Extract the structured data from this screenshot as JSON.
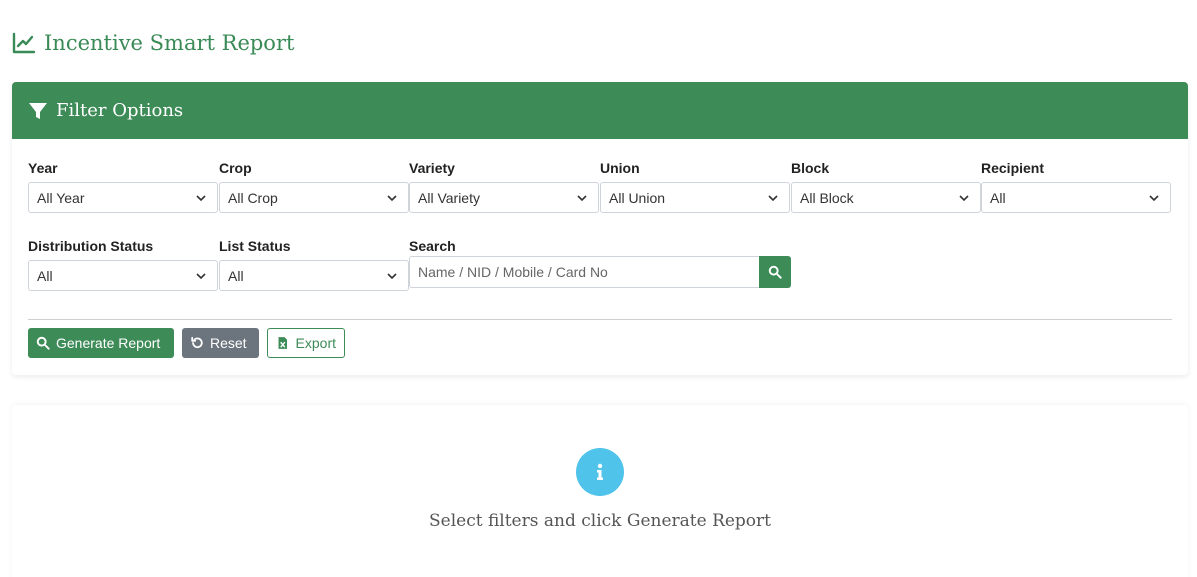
{
  "page": {
    "title": "Incentive Smart Report",
    "title_icon": "line-chart-icon"
  },
  "filter_panel": {
    "header": "Filter Options",
    "header_icon": "filter-icon",
    "fields": [
      {
        "label": "Year",
        "value": "All Year"
      },
      {
        "label": "Crop",
        "value": "All Crop"
      },
      {
        "label": "Variety",
        "value": "All Variety"
      },
      {
        "label": "Union",
        "value": "All Union"
      },
      {
        "label": "Block",
        "value": "All Block"
      },
      {
        "label": "Recipient",
        "value": "All"
      },
      {
        "label": "Distribution Status",
        "value": "All"
      },
      {
        "label": "List Status",
        "value": "All"
      }
    ],
    "search": {
      "label": "Search",
      "placeholder": "Name / NID / Mobile / Card No"
    }
  },
  "actions": {
    "generate": "Generate Report",
    "reset": "Reset",
    "export": "Export"
  },
  "results": {
    "empty_message": "Select filters and click Generate Report",
    "icon": "info-icon"
  },
  "colors": {
    "primary": "#3d8b57",
    "secondary": "#6c757d",
    "info": "#4fc3ea"
  }
}
